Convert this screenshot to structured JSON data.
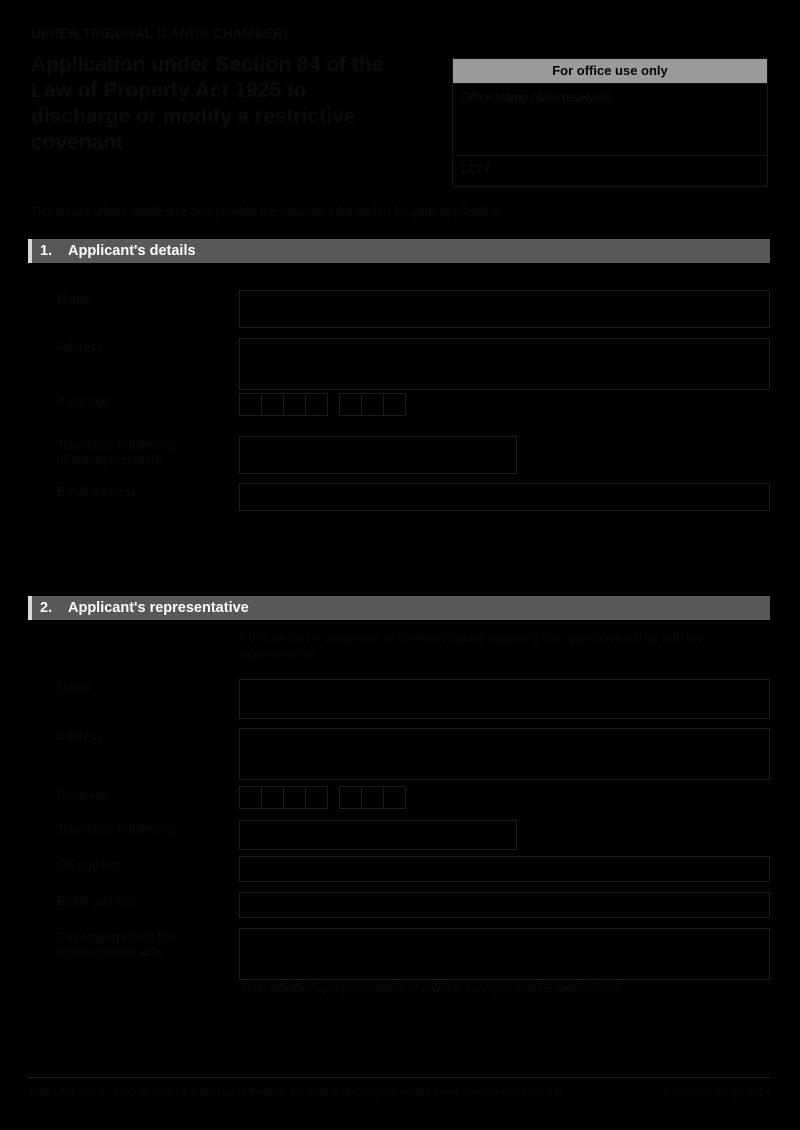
{
  "header": {
    "organisation": "UPPER TRIBUNAL (LANDS CHAMBER)",
    "title": "Application under Section 84 of the Law of Property Act 1925 to discharge or modify a restrictive covenant"
  },
  "office_box": {
    "heading": "For office use only",
    "stamp_label": "Office stamp (date received)",
    "reference": "LC/                    /"
  },
  "instruction": "Tick boxes where applicable and provide the relevant information for your application.",
  "sections": [
    {
      "number": "1.",
      "title": "Applicant's details",
      "fields": [
        {
          "label": "Name",
          "value": "",
          "type": "text"
        },
        {
          "label": "Address",
          "value": "",
          "type": "textarea"
        },
        {
          "label": "Postcode",
          "value": "",
          "type": "postcode"
        },
        {
          "label": "Telephone number(s)\n(if not represented)",
          "value": "",
          "type": "text"
        },
        {
          "label": "Email address",
          "value": "",
          "type": "text"
        }
      ]
    },
    {
      "number": "2.",
      "title": "Applicant's representative",
      "note": "If this section is completed all communications regarding this application will be with the representative.",
      "fields": [
        {
          "label": "Name",
          "value": "",
          "type": "text"
        },
        {
          "label": "Address",
          "value": "",
          "type": "textarea"
        },
        {
          "label": "Postcode",
          "value": "",
          "type": "postcode"
        },
        {
          "label": "Telephone number(s)",
          "value": "",
          "type": "text"
        },
        {
          "label": "DX number",
          "value": "",
          "type": "text"
        },
        {
          "label": "Email address",
          "value": "",
          "type": "text"
        },
        {
          "label": "Capacity in which the\nrepresentative acts",
          "value": "",
          "type": "textarea"
        }
      ],
      "footnote": "State whether lay representative or solicitor, surveyor or other professional."
    }
  ],
  "footer": {
    "left": "T598 - Application under Section 84 of the Law of Property Act 1925 to discharge or modify a restrictive covenant (06.24)",
    "right": "© Crown copyright 2024"
  },
  "colors": {
    "section_bar": "#585858",
    "office_head": "#9a9a9a",
    "border": "#1b1b1b"
  }
}
